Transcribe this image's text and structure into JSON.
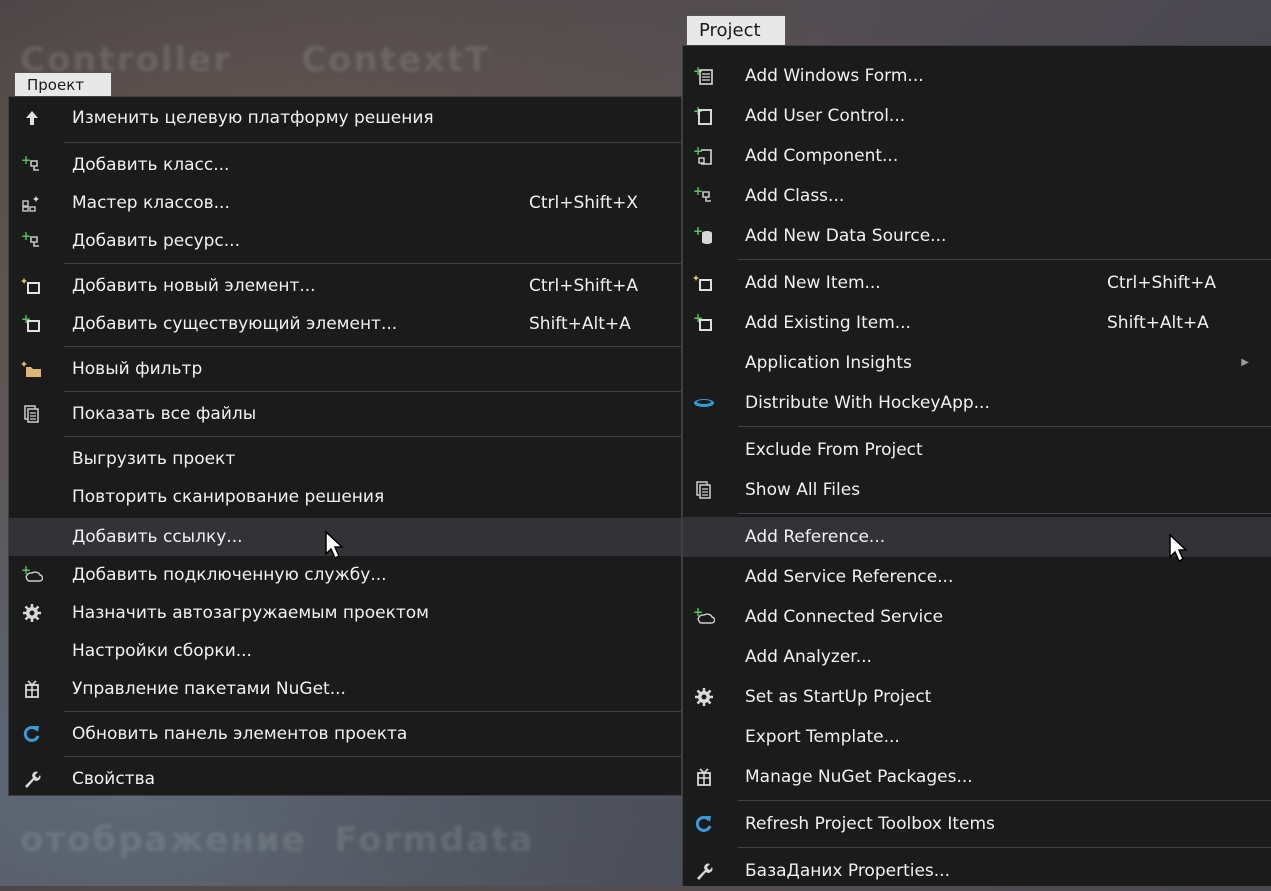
{
  "left_menu": {
    "title": "Проект",
    "items": [
      {
        "label": "Изменить целевую платформу решения",
        "icon": "arrow-up-icon",
        "shortcut": ""
      },
      {
        "label": "Добавить класс...",
        "icon": "add-class-icon",
        "shortcut": ""
      },
      {
        "label": "Мастер классов...",
        "icon": "class-wizard-icon",
        "shortcut": "Ctrl+Shift+X"
      },
      {
        "label": "Добавить ресурс...",
        "icon": "add-resource-icon",
        "shortcut": ""
      },
      {
        "label": "Добавить новый элемент...",
        "icon": "add-new-item-icon",
        "shortcut": "Ctrl+Shift+A"
      },
      {
        "label": "Добавить существующий элемент...",
        "icon": "add-existing-item-icon",
        "shortcut": "Shift+Alt+A"
      },
      {
        "label": "Новый фильтр",
        "icon": "new-filter-folder-icon",
        "shortcut": ""
      },
      {
        "label": "Показать все файлы",
        "icon": "show-all-files-icon",
        "shortcut": ""
      },
      {
        "label": "Выгрузить проект",
        "icon": "",
        "shortcut": ""
      },
      {
        "label": "Повторить сканирование решения",
        "icon": "",
        "shortcut": ""
      },
      {
        "label": "Добавить ссылку...",
        "icon": "",
        "shortcut": ""
      },
      {
        "label": "Добавить подключенную службу...",
        "icon": "connected-service-icon",
        "shortcut": ""
      },
      {
        "label": "Назначить автозагружаемым проектом",
        "icon": "gear-icon",
        "shortcut": ""
      },
      {
        "label": "Настройки сборки...",
        "icon": "",
        "shortcut": ""
      },
      {
        "label": "Управление пакетами NuGet...",
        "icon": "nuget-package-icon",
        "shortcut": ""
      },
      {
        "label": "Обновить панель элементов проекта",
        "icon": "refresh-icon",
        "shortcut": ""
      },
      {
        "label": "Свойства",
        "icon": "wrench-icon",
        "shortcut": ""
      }
    ]
  },
  "right_menu": {
    "title": "Project",
    "items": [
      {
        "label": "Add Windows Form...",
        "icon": "add-windows-form-icon",
        "shortcut": ""
      },
      {
        "label": "Add User Control...",
        "icon": "add-user-control-icon",
        "shortcut": ""
      },
      {
        "label": "Add Component...",
        "icon": "add-component-icon",
        "shortcut": ""
      },
      {
        "label": "Add Class...",
        "icon": "add-class-icon",
        "shortcut": ""
      },
      {
        "label": "Add New Data Source...",
        "icon": "add-data-source-icon",
        "shortcut": ""
      },
      {
        "label": "Add New Item...",
        "icon": "add-new-item-icon",
        "shortcut": "Ctrl+Shift+A"
      },
      {
        "label": "Add Existing Item...",
        "icon": "add-existing-item-icon",
        "shortcut": "Shift+Alt+A"
      },
      {
        "label": "Application Insights",
        "icon": "",
        "shortcut": ""
      },
      {
        "label": "Distribute With HockeyApp...",
        "icon": "hockeyapp-icon",
        "shortcut": ""
      },
      {
        "label": "Exclude From Project",
        "icon": "",
        "shortcut": ""
      },
      {
        "label": "Show All Files",
        "icon": "show-all-files-icon",
        "shortcut": ""
      },
      {
        "label": "Add Reference...",
        "icon": "",
        "shortcut": ""
      },
      {
        "label": "Add Service Reference...",
        "icon": "",
        "shortcut": ""
      },
      {
        "label": "Add Connected Service",
        "icon": "connected-service-icon",
        "shortcut": ""
      },
      {
        "label": "Add Analyzer...",
        "icon": "",
        "shortcut": ""
      },
      {
        "label": "Set as StartUp Project",
        "icon": "gear-icon",
        "shortcut": ""
      },
      {
        "label": "Export Template...",
        "icon": "",
        "shortcut": ""
      },
      {
        "label": "Manage NuGet Packages...",
        "icon": "nuget-package-icon",
        "shortcut": ""
      },
      {
        "label": "Refresh Project Toolbox Items",
        "icon": "refresh-icon",
        "shortcut": ""
      },
      {
        "label": "БазаДаних Properties...",
        "icon": "wrench-icon",
        "shortcut": ""
      }
    ]
  },
  "colors": {
    "menu_bg": "#1b1b1c",
    "menu_text": "#f1f1f1",
    "highlight_bg": "#333337",
    "separator": "#3f3f46",
    "title_bg": "#e8e8e8",
    "plus_green": "#57c35a",
    "refresh_blue": "#3a9bdc"
  }
}
